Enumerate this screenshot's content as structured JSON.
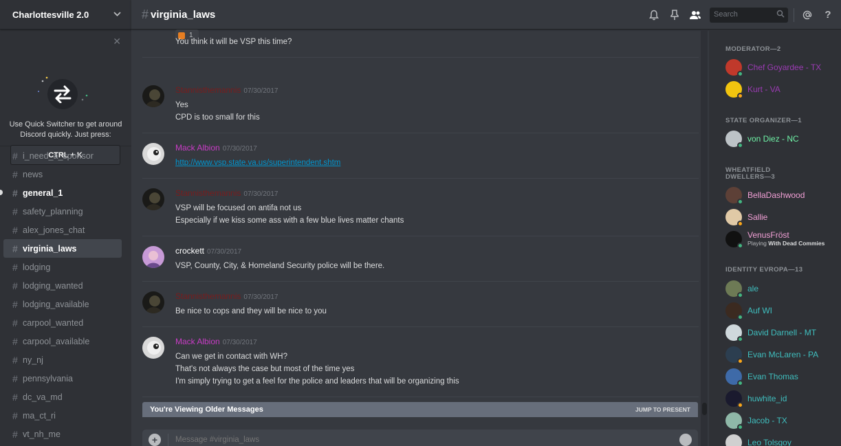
{
  "server": {
    "name": "Charlottesville 2.0",
    "quick_switcher": {
      "text_line1": "Use Quick Switcher to get around",
      "text_line2": "Discord quickly. Just press:",
      "shortcut": "CTRL + K"
    },
    "channels": [
      {
        "name": "i_need_a_sponsor",
        "state": "normal"
      },
      {
        "name": "news",
        "state": "normal"
      },
      {
        "name": "general_1",
        "state": "unread"
      },
      {
        "name": "safety_planning",
        "state": "normal"
      },
      {
        "name": "alex_jones_chat",
        "state": "normal"
      },
      {
        "name": "virginia_laws",
        "state": "active"
      },
      {
        "name": "lodging",
        "state": "normal"
      },
      {
        "name": "lodging_wanted",
        "state": "normal"
      },
      {
        "name": "lodging_available",
        "state": "normal"
      },
      {
        "name": "carpool_wanted",
        "state": "normal"
      },
      {
        "name": "carpool_available",
        "state": "normal"
      },
      {
        "name": "ny_nj",
        "state": "normal"
      },
      {
        "name": "pennsylvania",
        "state": "normal"
      },
      {
        "name": "dc_va_md",
        "state": "normal"
      },
      {
        "name": "ma_ct_ri",
        "state": "normal"
      },
      {
        "name": "vt_nh_me",
        "state": "normal"
      }
    ]
  },
  "header": {
    "channel_hash": "#",
    "channel_name": "virginia_laws",
    "search_placeholder": "Search",
    "icons": [
      "bell-icon",
      "pin-icon",
      "members-icon",
      "search-icon",
      "mention-icon",
      "help-icon"
    ]
  },
  "messages": [
    {
      "reaction_count": "1",
      "lines": [
        "You think it will be VSP this time?"
      ]
    },
    {
      "author": "Stannisthemannis",
      "color": "#7a1c1c",
      "timestamp": "07/30/2017",
      "lines": [
        "Yes",
        "CPD is too small for this"
      ]
    },
    {
      "author": "Mack Albion",
      "color": "#c93cc6",
      "timestamp": "07/30/2017",
      "lines": [
        "http://www.vsp.state.va.us/superintendent.shtm"
      ]
    },
    {
      "author": "Stannisthemannis",
      "color": "#7a1c1c",
      "timestamp": "07/30/2017",
      "lines": [
        "VSP will be focused on antifa not us",
        "Especially if we kiss some ass with a few blue lives matter chants"
      ]
    },
    {
      "author": "crockett",
      "color": "#ffffff",
      "timestamp": "07/30/2017",
      "lines": [
        "VSP, County, City, & Homeland Security police will be there."
      ]
    },
    {
      "author": "Stannisthemannis",
      "color": "#7a1c1c",
      "timestamp": "07/30/2017",
      "lines": [
        "Be nice to cops and they will be nice to you"
      ]
    },
    {
      "author": "Mack Albion",
      "color": "#c93cc6",
      "timestamp": "07/30/2017",
      "lines": [
        "Can we get in contact with WH?",
        "That's not always the case but most of the time yes",
        "I'm simply trying to get a feel for the police and leaders that will be organizing this"
      ]
    }
  ],
  "older_bar": {
    "label": "You're Viewing Older Messages",
    "jump": "JUMP TO PRESENT"
  },
  "composer": {
    "placeholder": "Message #virginia_laws"
  },
  "members": {
    "roles": [
      {
        "title": "MODERATOR—2",
        "people": [
          {
            "name": "Chef Goyardee - TX",
            "color": "#9b3bb3",
            "status": "#43b581"
          },
          {
            "name": "Kurt - VA",
            "color": "#9b3bb3",
            "status": "#faa61a"
          }
        ]
      },
      {
        "title": "STATE ORGANIZER—1",
        "people": [
          {
            "name": "von Diez - NC",
            "color": "#6ff3a7",
            "status": "#43b581"
          }
        ]
      },
      {
        "title": "WHEATFIELD DWELLERS—3",
        "people": [
          {
            "name": "BellaDashwood",
            "color": "#f2a0d6",
            "status": "#43b581"
          },
          {
            "name": "Sallie",
            "color": "#f2a0d6",
            "status": "#faa61a"
          },
          {
            "name": "VenusFröst",
            "color": "#f2a0d6",
            "status": "#43b581",
            "activity_prefix": "Playing",
            "activity": "With Dead Commies"
          }
        ]
      },
      {
        "title": "IDENTITY EVROPA—13",
        "people": [
          {
            "name": "ale",
            "color": "#3fbfbf",
            "status": "#43b581"
          },
          {
            "name": "Auf WI",
            "color": "#3fbfbf",
            "status": "#43b581"
          },
          {
            "name": "David Darnell - MT",
            "color": "#3fbfbf",
            "status": "#43b581"
          },
          {
            "name": "Evan McLaren - PA",
            "color": "#3fbfbf",
            "status": "#faa61a"
          },
          {
            "name": "Evan Thomas",
            "color": "#3fbfbf",
            "status": "#43b581"
          },
          {
            "name": "huwhite_id",
            "color": "#3fbfbf",
            "status": "#faa61a"
          },
          {
            "name": "Jacob - TX",
            "color": "#3fbfbf",
            "status": "#43b581"
          },
          {
            "name": "Leo Tolsgoy",
            "color": "#3fbfbf",
            "status": "#43b581"
          }
        ]
      }
    ]
  }
}
